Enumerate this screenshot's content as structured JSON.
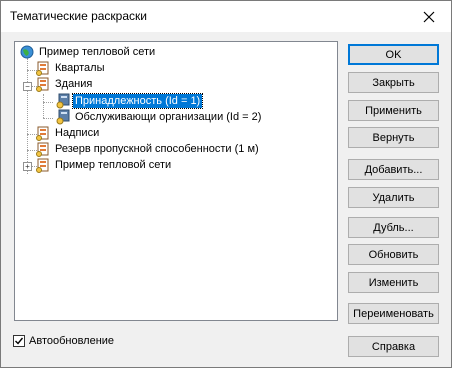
{
  "window": {
    "title": "Тематические раскраски"
  },
  "tree": {
    "items": [
      {
        "label": "Пример тепловой сети",
        "icon": "network-globe-icon"
      },
      {
        "label": "Кварталы",
        "icon": "layer-map-icon"
      },
      {
        "label": "Здания",
        "icon": "layer-map-icon"
      },
      {
        "label": "Принадлежность (Id = 1)",
        "icon": "thematic-layer-icon"
      },
      {
        "label": "Обслуживающи организации (Id = 2)",
        "icon": "thematic-layer-icon"
      },
      {
        "label": "Надписи",
        "icon": "layer-map-icon"
      },
      {
        "label": "Резерв пропускной способенности (1 м)",
        "icon": "layer-map-icon"
      },
      {
        "label": "Пример тепловой сети",
        "icon": "layer-map-icon"
      }
    ]
  },
  "buttons": {
    "ok": "OK",
    "close": "Закрыть",
    "apply": "Применить",
    "revert": "Вернуть",
    "add": "Добавить...",
    "delete": "Удалить",
    "duplicate": "Дубль...",
    "update": "Обновить",
    "edit": "Изменить",
    "rename": "Переименовать",
    "help": "Справка"
  },
  "autoupdate": {
    "label": "Автообновление",
    "checked": true
  },
  "colors": {
    "selection": "#0078d7",
    "default_button_border": "#0078d7"
  }
}
